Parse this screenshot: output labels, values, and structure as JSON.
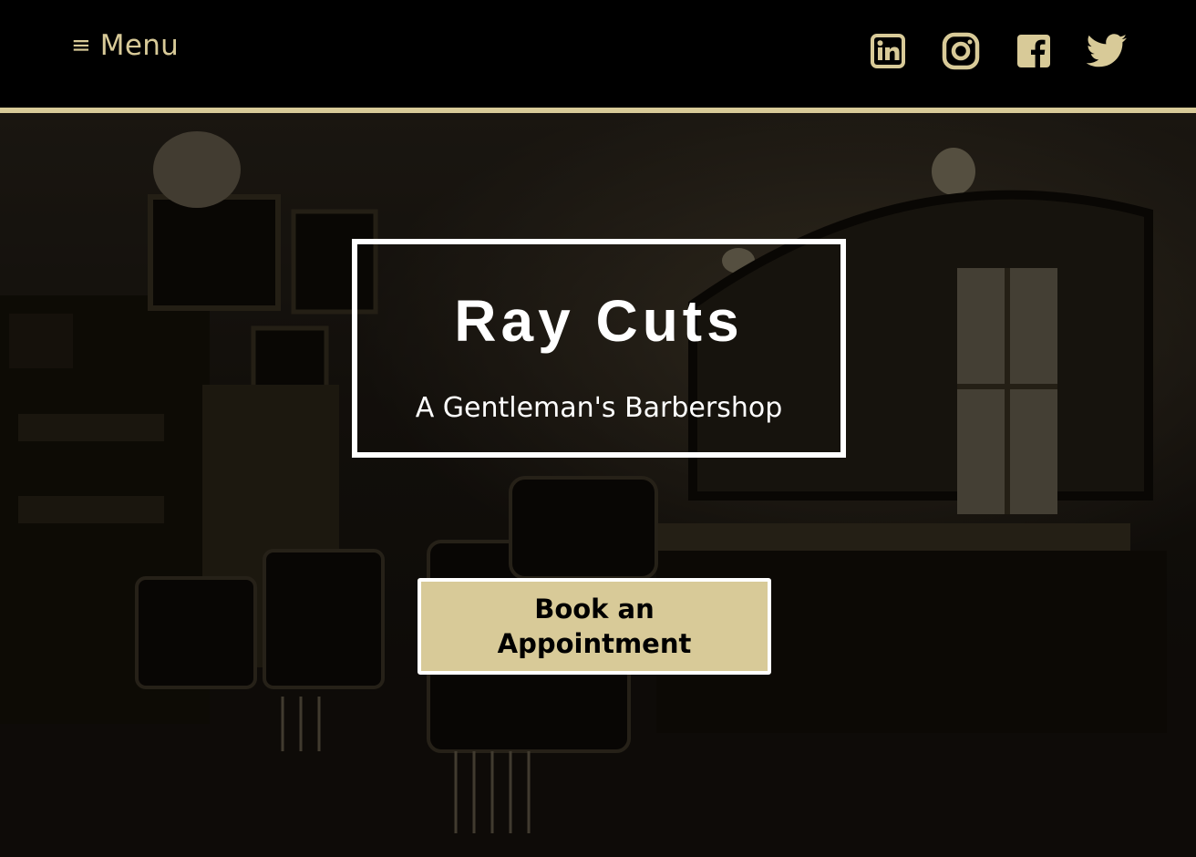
{
  "nav": {
    "menu_icon": "≡",
    "menu_label": "Menu",
    "social": [
      {
        "name": "linkedin-icon"
      },
      {
        "name": "instagram-icon"
      },
      {
        "name": "facebook-icon"
      },
      {
        "name": "twitter-icon"
      }
    ]
  },
  "hero": {
    "title": "Ray Cuts",
    "subtitle": "A Gentleman's Barbershop",
    "cta_label": "Book an Appointment",
    "background_image": "vintage-barbershop-interior"
  },
  "colors": {
    "accent": "#d8ca98",
    "nav_background": "#000000",
    "title_text": "#ffffff",
    "cta_text": "#000000"
  }
}
